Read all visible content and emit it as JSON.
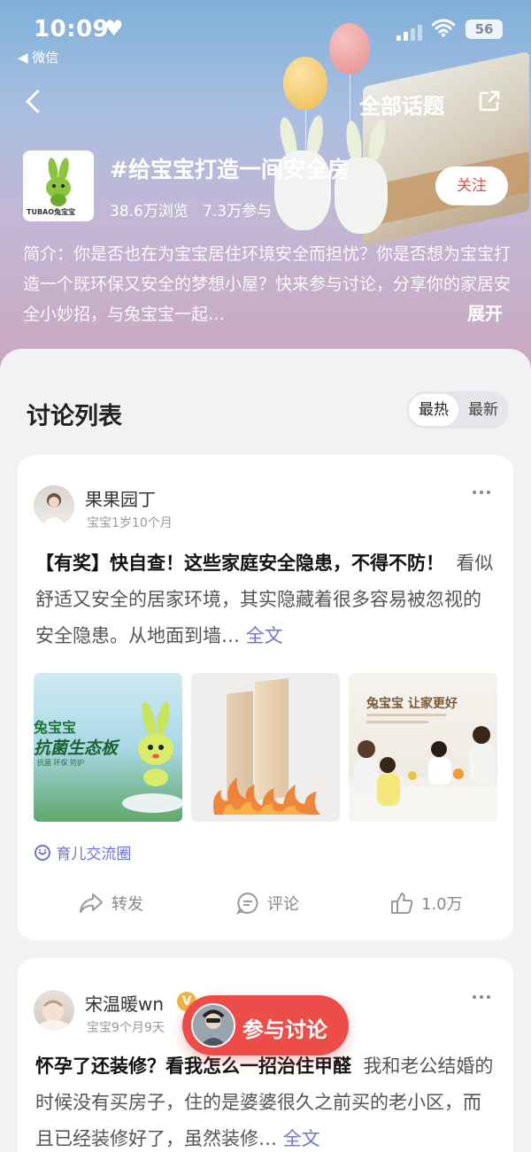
{
  "status_bar": {
    "time": "10:09",
    "back_app": "◀ 微信",
    "battery": "56"
  },
  "nav": {
    "all_topics": "全部话题"
  },
  "topic": {
    "title": "#给宝宝打造一间安全房",
    "views": "38.6万浏览",
    "participants": "7.3万参与",
    "follow_label": "关注",
    "logo_text": "TUBAO兔宝宝",
    "intro": "简介：你是否也在为宝宝居住环境安全而担忧？你是否想为宝宝打造一个既环保又安全的梦想小屋？快来参与讨论，分享你的家居安全小妙招，与兔宝宝一起…",
    "expand_label": "展开"
  },
  "discussion": {
    "title": "讨论列表",
    "sort": {
      "hot": "最热",
      "new": "最新"
    }
  },
  "posts": [
    {
      "author": "果果园丁",
      "baby_age": "宝宝1岁10个月",
      "title": "【有奖】快自查！这些家庭安全隐患，不得不防！",
      "body": "看似舒适又安全的居家环境，其实隐藏着很多容易被忽视的安全隐患。从地面到墙…",
      "full_label": "全文",
      "images": [
        {
          "caption_1": "兔宝宝",
          "caption_2": "抗菌生态板",
          "caption_3": "抗菌 环保 防护"
        },
        {
          "caption_1": ""
        },
        {
          "caption_1": "兔宝宝 让家更好"
        }
      ],
      "circle": "育儿交流圈",
      "actions": {
        "share": "转发",
        "comment": "评论",
        "like": "1.0万"
      }
    },
    {
      "author": "宋温暖wn",
      "badge": "V",
      "baby_age": "宝宝9个月9天",
      "title": "怀孕了还装修？看我怎么一招治住甲醛",
      "body": "我和老公结婚的时候没有买房子，住的是婆婆很久之前买的老小区，而且已经装修好了，虽然装修…",
      "full_label": "全文"
    }
  ],
  "floating": {
    "join_label": "参与讨论"
  }
}
